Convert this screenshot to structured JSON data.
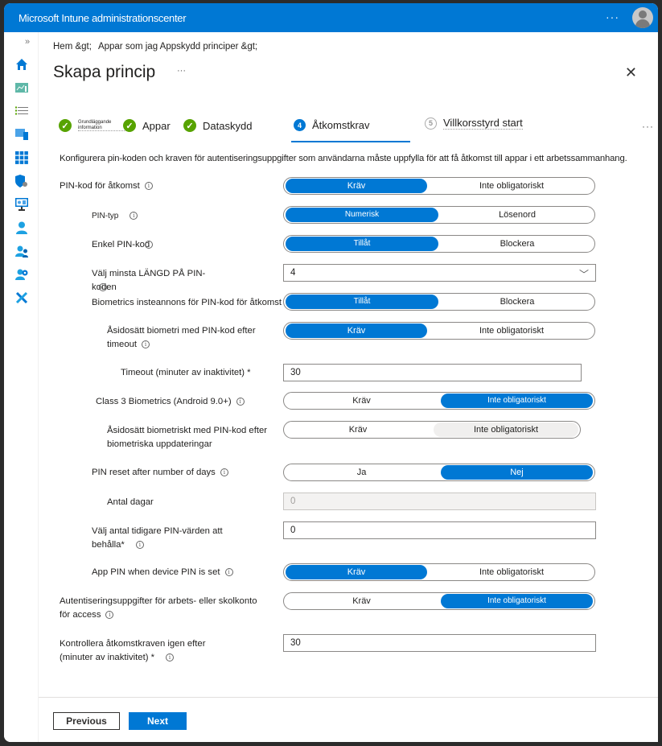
{
  "app": {
    "title": "Microsoft Intune administrationscenter",
    "more_label": "···"
  },
  "sidebar": {
    "expand_label": "»",
    "items": [
      {
        "icon": "home-icon"
      },
      {
        "icon": "dashboard-icon"
      },
      {
        "icon": "list-icon"
      },
      {
        "icon": "devices-icon"
      },
      {
        "icon": "apps-icon"
      },
      {
        "icon": "endpoint-security-icon"
      },
      {
        "icon": "reports-icon"
      },
      {
        "icon": "users-icon"
      },
      {
        "icon": "groups-icon"
      },
      {
        "icon": "tenant-admin-icon"
      },
      {
        "icon": "troubleshooting-icon"
      }
    ]
  },
  "breadcrumb": {
    "items": [
      "Hem &gt;",
      "Appar som jag Appskydd principer &gt;"
    ]
  },
  "page": {
    "title": "Skapa princip",
    "more_label": "···",
    "close_label": "✕"
  },
  "steps": [
    {
      "label": "Grundläggande information",
      "state": "done"
    },
    {
      "label": "Appar",
      "state": "done"
    },
    {
      "label": "Dataskydd",
      "state": "done"
    },
    {
      "number": "4",
      "label": "Åtkomstkrav",
      "state": "active"
    },
    {
      "number": "5",
      "label": "Villkorsstyrd start",
      "state": "pending"
    }
  ],
  "steps_more": "···",
  "description": "Konfigurera pin-koden och kraven för autentiseringsuppgifter som användarna måste uppfylla för att få åtkomst till appar i ett arbetssammanhang.",
  "settings": {
    "pin_access": {
      "label": "PIN-kod för åtkomst",
      "options": [
        "Kräv",
        "Inte obligatoriskt"
      ],
      "selected": "Kräv"
    },
    "pin_type": {
      "label": "PIN-typ",
      "options": [
        "Numerisk",
        "Lösenord"
      ],
      "selected": "Numerisk"
    },
    "simple_pin": {
      "label": "Enkel PIN-kod",
      "options": [
        "Tillåt",
        "Blockera"
      ],
      "selected": "Tillåt"
    },
    "min_length": {
      "label": "Välj minsta LÄNGD PÅ PIN-koden",
      "value": "4"
    },
    "biometrics": {
      "label": "Biometrics insteannons för PIN-kod för åtkomst",
      "options": [
        "Tillåt",
        "Blockera"
      ],
      "selected": "Tillåt"
    },
    "override_biometrics": {
      "label": "Åsidosätt biometri med PIN-kod efter timeout",
      "options": [
        "Kräv",
        "Inte obligatoriskt"
      ],
      "selected": "Kräv"
    },
    "timeout": {
      "label": "Timeout (minuter av inaktivitet) *",
      "value": "30"
    },
    "class3": {
      "label": "Class 3 Biometrics (Android 9.0+)",
      "options": [
        "Kräv",
        "Inte obligatoriskt"
      ],
      "selected": "Inte obligatoriskt"
    },
    "override_bio_updates": {
      "label": "Åsidosätt biometriskt med PIN-kod efter biometriska uppdateringar",
      "options": [
        "Kräv",
        "Inte obligatoriskt"
      ],
      "selected": "none"
    },
    "pin_reset": {
      "label": "PIN reset after number of days",
      "options": [
        "Ja",
        "Nej"
      ],
      "selected": "Nej"
    },
    "days": {
      "label": "Antal dagar",
      "value": "0"
    },
    "previous_pins": {
      "label": "Välj antal tidigare PIN-värden att behålla*",
      "value": "0"
    },
    "app_pin_device": {
      "label": "App PIN when device PIN is set",
      "options": [
        "Kräv",
        "Inte obligatoriskt"
      ],
      "selected": "Kräv"
    },
    "work_creds": {
      "label": "Autentiseringsuppgifter för arbets- eller skolkonto för access",
      "options": [
        "Kräv",
        "Inte obligatoriskt"
      ],
      "selected": "Inte obligatoriskt"
    },
    "recheck": {
      "label": "Kontrollera åtkomstkraven igen efter (minuter av inaktivitet) *",
      "value": "30"
    }
  },
  "footer": {
    "previous_label": "Previous",
    "next_label": "Next"
  },
  "colors": {
    "accent": "#0078d4",
    "success": "#57a300"
  }
}
